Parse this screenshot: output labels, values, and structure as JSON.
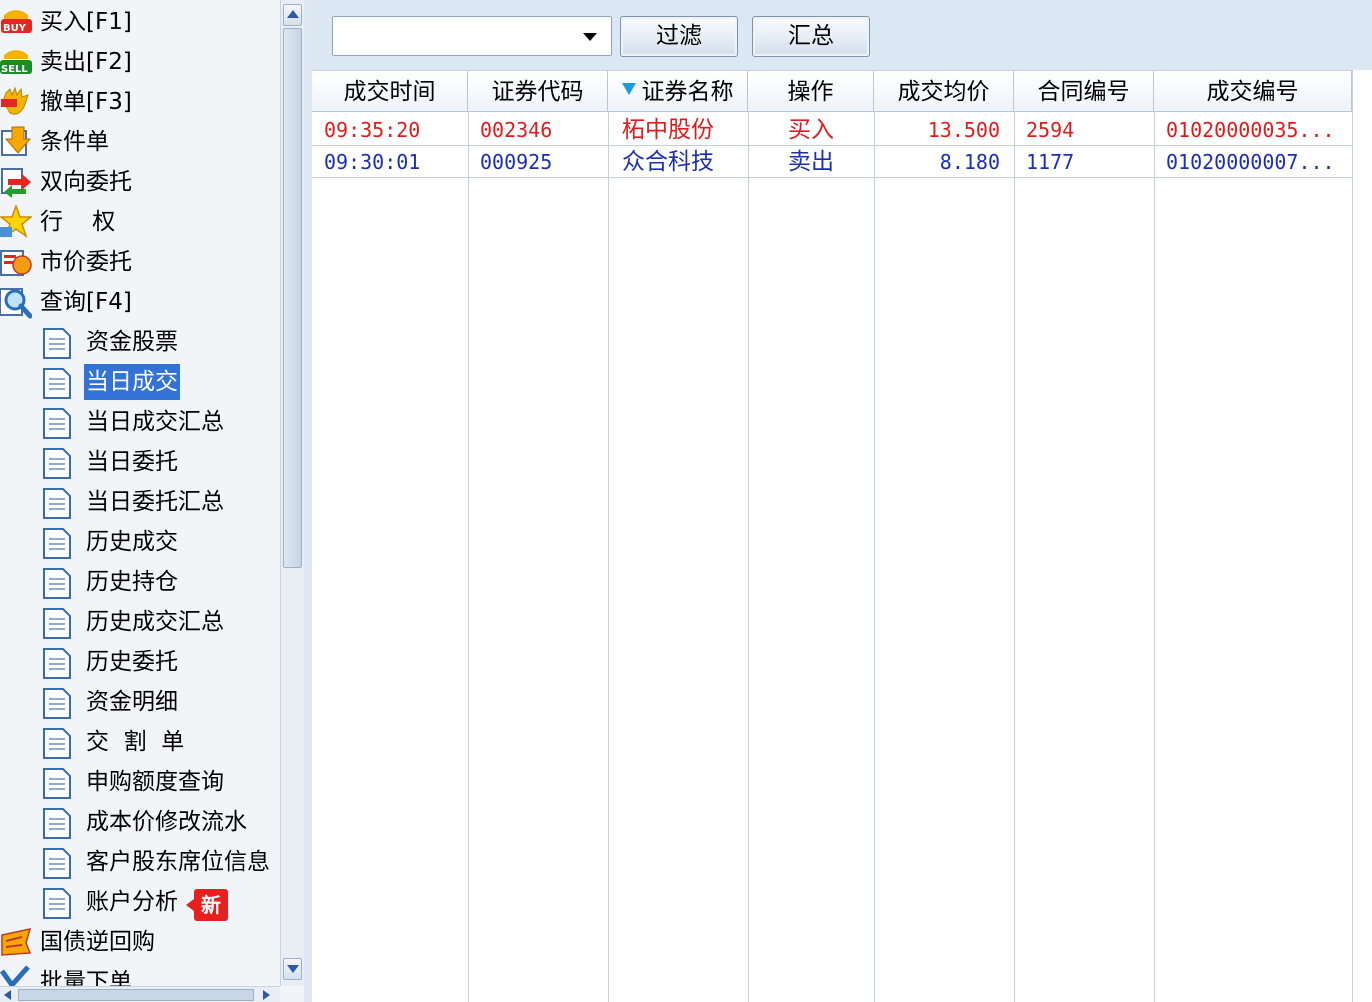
{
  "nav": {
    "items": [
      {
        "label": "买入[F1]",
        "icon": "buy-icon"
      },
      {
        "label": "卖出[F2]",
        "icon": "sell-icon"
      },
      {
        "label": "撤单[F3]",
        "icon": "cancel-order-icon"
      },
      {
        "label": "条件单",
        "icon": "condition-order-icon"
      },
      {
        "label": "双向委托",
        "icon": "two-way-order-icon"
      },
      {
        "label": "行    权",
        "icon": "exercise-star-icon"
      },
      {
        "label": "市价委托",
        "icon": "market-order-icon"
      },
      {
        "label": "查询[F4]",
        "icon": "query-magnifier-icon"
      }
    ],
    "sub_items": [
      {
        "label": "资金股票"
      },
      {
        "label": "当日成交",
        "selected": true
      },
      {
        "label": "当日成交汇总"
      },
      {
        "label": "当日委托"
      },
      {
        "label": "当日委托汇总"
      },
      {
        "label": "历史成交"
      },
      {
        "label": "历史持仓"
      },
      {
        "label": "历史成交汇总"
      },
      {
        "label": "历史委托"
      },
      {
        "label": "资金明细"
      },
      {
        "label": "交  割  单"
      },
      {
        "label": "申购额度查询"
      },
      {
        "label": "成本价修改流水"
      },
      {
        "label": "客户股东席位信息"
      },
      {
        "label": "账户分析",
        "badge": "新"
      }
    ],
    "bottom_items": [
      {
        "label": "国债逆回购",
        "icon": "repo-icon"
      },
      {
        "label": "批量下单",
        "icon": "batch-order-icon"
      }
    ]
  },
  "toolbar": {
    "filter_value": "",
    "filter_button": "过滤",
    "summary_button": "汇总"
  },
  "table": {
    "headers": [
      "成交时间",
      "证券代码",
      "证券名称",
      "操作",
      "成交均价",
      "合同编号",
      "成交编号"
    ],
    "sorted_column": "证券名称",
    "rows": [
      {
        "time": "09:35:20",
        "code": "002346",
        "name": "柘中股份",
        "action": "买入",
        "price": "13.500",
        "contract": "2594",
        "deal_no": "01020000035...",
        "color": "#e01b1b"
      },
      {
        "time": "09:30:01",
        "code": "000925",
        "name": "众合科技",
        "action": "卖出",
        "price": "8.180",
        "contract": "1177",
        "deal_no": "01020000007...",
        "color": "#1b2fb0"
      }
    ]
  },
  "colors": {
    "buy": "#e01b1b",
    "sell": "#1b2fb0",
    "selection": "#3372d6",
    "toolbar_bg": "#dce7f4"
  }
}
